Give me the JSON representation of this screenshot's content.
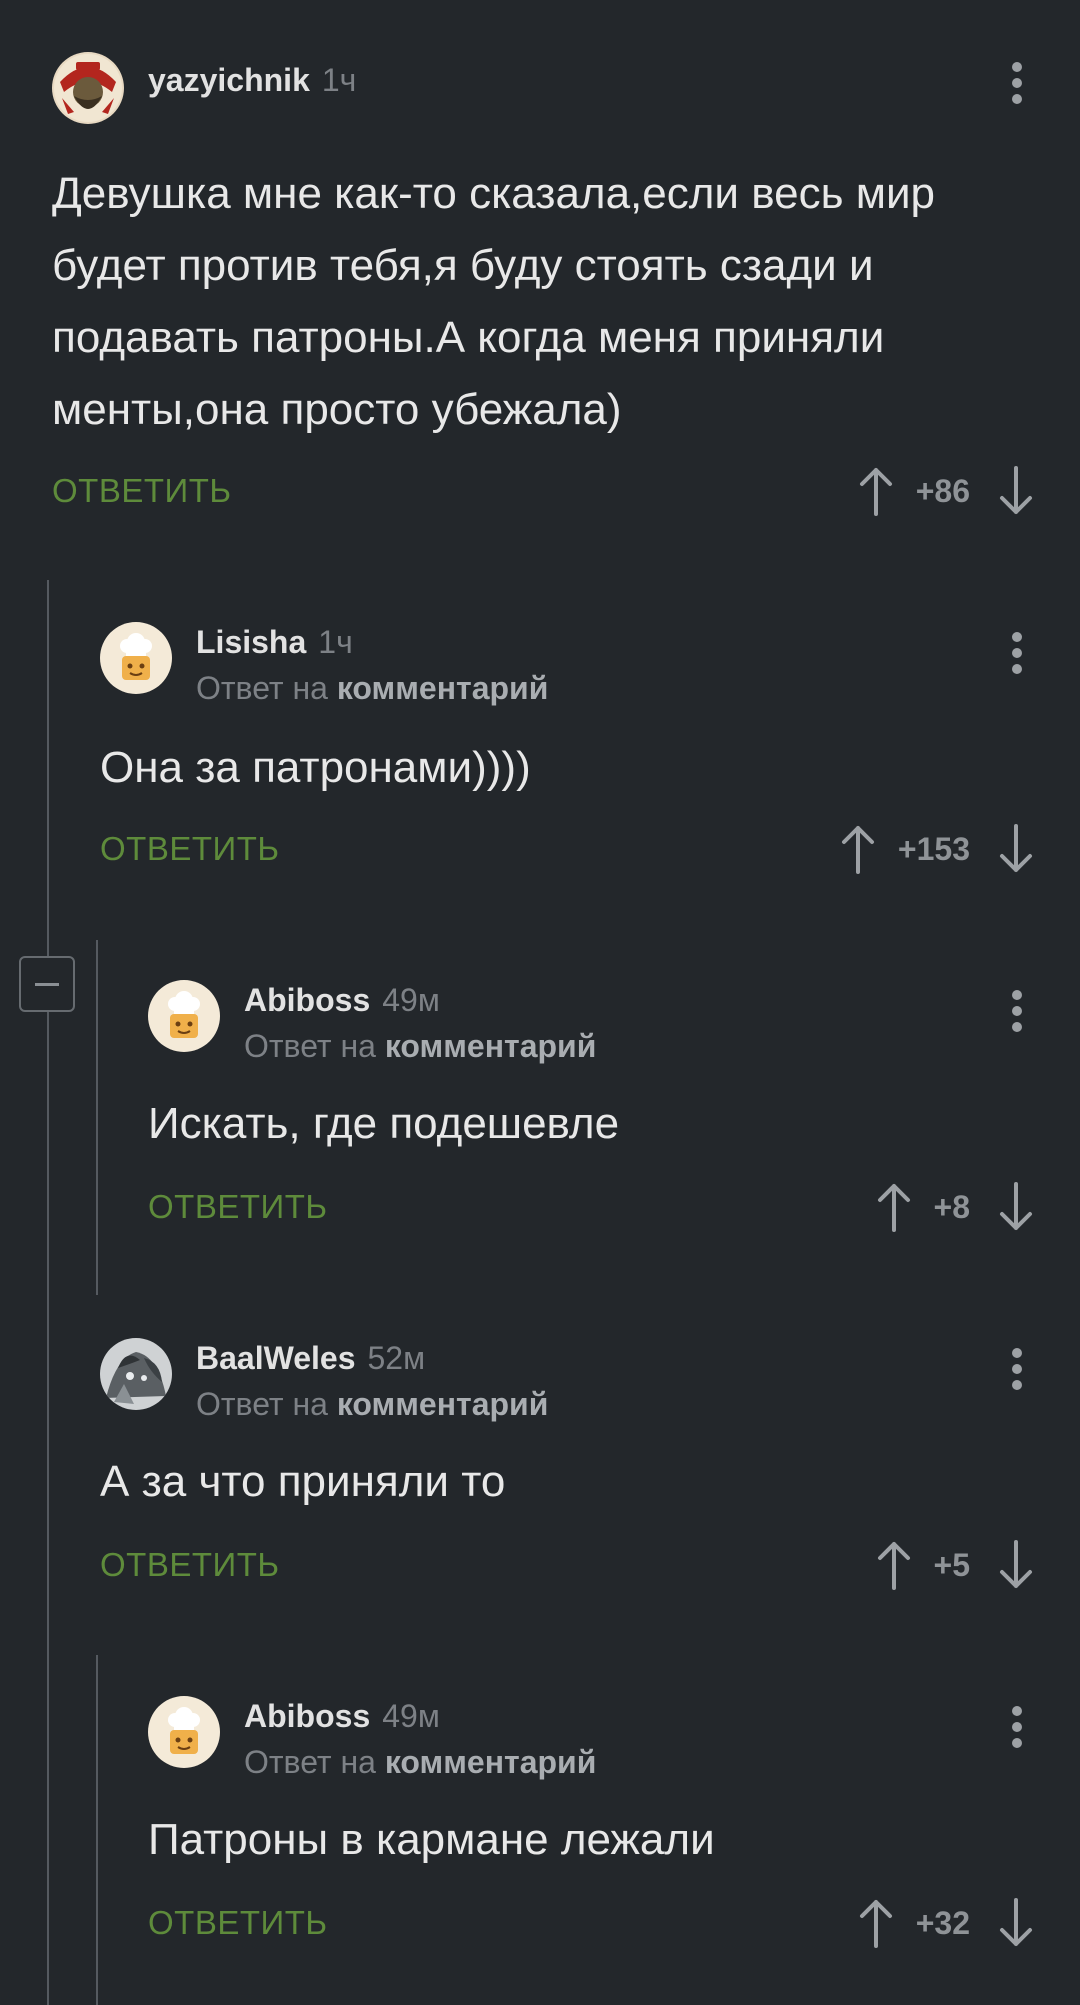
{
  "ui": {
    "reply_label": "ОТВЕТИТЬ",
    "reply_to_prefix": "Ответ на",
    "reply_to_link": "комментарий",
    "accent": "#5e8b3b",
    "background": "#23272b"
  },
  "comments": [
    {
      "author": "yazyichnik",
      "time": "1ч",
      "avatar": "bearded-man-emblem-avatar",
      "text": [
        "Девушка мне как-то сказала,если весь мир",
        "будет против тебя,я буду стоять сзади и",
        "подавать патроны.А когда меня приняли",
        "менты,она просто убежала)"
      ],
      "rating": "+86"
    },
    {
      "author": "Lisisha",
      "time": "1ч",
      "avatar": "default-cook-avatar",
      "text": [
        "Она за патронами))))"
      ],
      "rating": "+153"
    },
    {
      "author": "Abiboss",
      "time": "49м",
      "avatar": "default-cook-avatar",
      "text": [
        "Искать, где подешевле"
      ],
      "rating": "+8"
    },
    {
      "author": "BaalWeles",
      "time": "52м",
      "avatar": "grey-creature-avatar",
      "text": [
        "А за что приняли то"
      ],
      "rating": "+5"
    },
    {
      "author": "Abiboss",
      "time": "49м",
      "avatar": "default-cook-avatar",
      "text": [
        "Патроны в кармане лежали"
      ],
      "rating": "+32"
    }
  ]
}
